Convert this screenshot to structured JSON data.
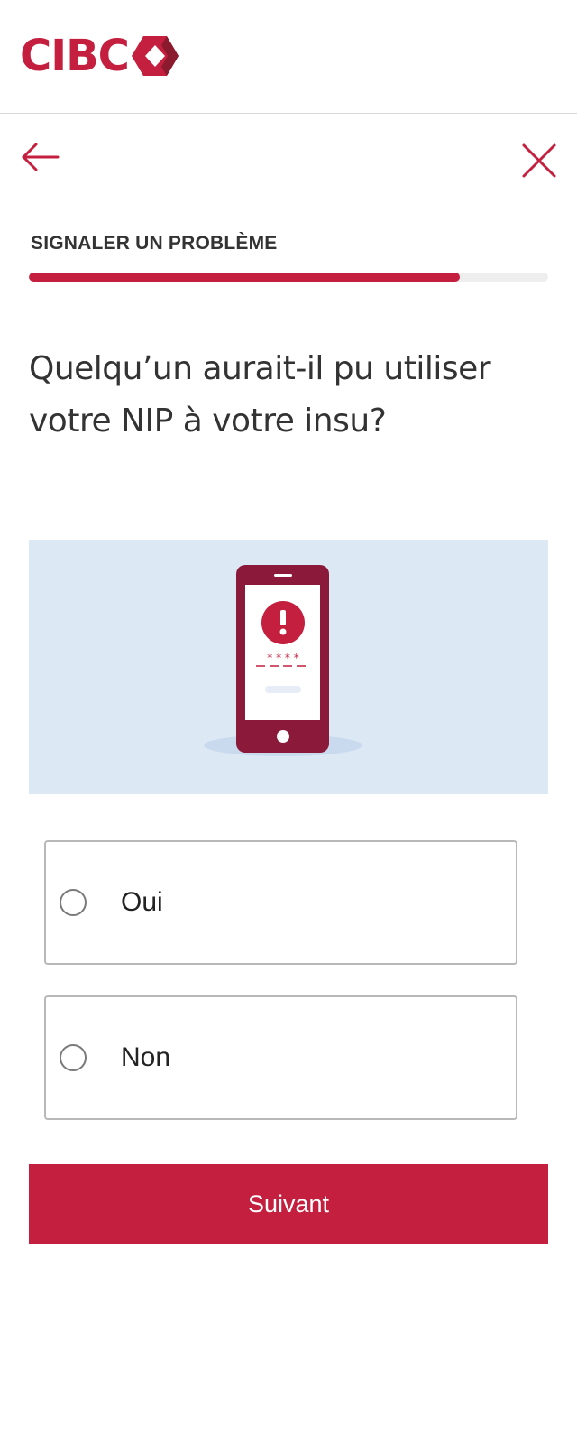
{
  "brand": {
    "name": "CIBC",
    "logo_icon": "cibc-diamond-icon",
    "accent_color": "#c41f3e"
  },
  "nav": {
    "back_icon": "arrow-left-icon",
    "close_icon": "close-icon"
  },
  "section": {
    "title": "SIGNALER UN PROBLÈME",
    "progress": 0.83
  },
  "question": "Quelqu’un aurait-il pu utiliser votre NIP à votre insu?",
  "illustration": {
    "icon": "phone-alert-icon",
    "background_color": "#dde8f5"
  },
  "options": [
    {
      "label": "Oui",
      "selected": false
    },
    {
      "label": "Non",
      "selected": false
    }
  ],
  "next_button": {
    "label": "Suivant"
  }
}
